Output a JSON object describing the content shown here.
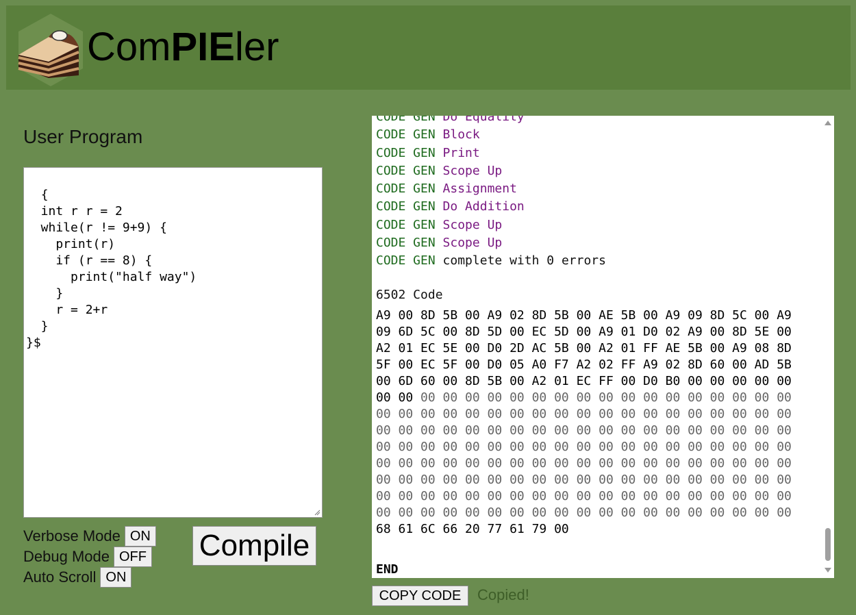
{
  "app": {
    "title_prefix": "Com",
    "title_bold": "PIE",
    "title_suffix": "ler",
    "logo_icon": "pie-slice-logo"
  },
  "editor": {
    "label": "User Program",
    "code": "{\n  int r r = 2\n  while(r != 9+9) {\n    print(r)\n    if (r == 8) {\n      print(\"half way\")\n    }\n    r = 2+r\n  }\n}$"
  },
  "options": {
    "verbose": {
      "label": "Verbose Mode",
      "value": "ON"
    },
    "debug": {
      "label": "Debug Mode",
      "value": "OFF"
    },
    "autoscroll": {
      "label": "Auto Scroll",
      "value": "ON"
    }
  },
  "compile_label": "Compile",
  "output": {
    "codegen_lines": [
      {
        "tag": "CODE GEN",
        "text": "Do Equality",
        "kind": "purple"
      },
      {
        "tag": "CODE GEN",
        "text": "Block",
        "kind": "purple"
      },
      {
        "tag": "CODE GEN",
        "text": "Print",
        "kind": "purple"
      },
      {
        "tag": "CODE GEN",
        "text": "Scope Up",
        "kind": "purple"
      },
      {
        "tag": "CODE GEN",
        "text": "Assignment",
        "kind": "purple"
      },
      {
        "tag": "CODE GEN",
        "text": "Do Addition",
        "kind": "purple"
      },
      {
        "tag": "CODE GEN",
        "text": "Scope Up",
        "kind": "purple"
      },
      {
        "tag": "CODE GEN",
        "text": "Scope Up",
        "kind": "purple"
      },
      {
        "tag": "CODE GEN",
        "text": "complete with 0 errors",
        "kind": "black"
      }
    ],
    "code_title": "6502 Code",
    "hex_lines": [
      {
        "dark": "A9 00 8D 5B 00 A9 02 8D 5B 00 AE 5B 00 A9 09 8D 5C 00 A9",
        "gray": ""
      },
      {
        "dark": "09 6D 5C 00 8D 5D 00 EC 5D 00 A9 01 D0 02 A9 00 8D 5E 00",
        "gray": ""
      },
      {
        "dark": "A2 01 EC 5E 00 D0 2D AC 5B 00 A2 01 FF AE 5B 00 A9 08 8D",
        "gray": ""
      },
      {
        "dark": "5F 00 EC 5F 00 D0 05 A0 F7 A2 02 FF A9 02 8D 60 00 AD 5B",
        "gray": ""
      },
      {
        "dark": "00 6D 60 00 8D 5B 00 A2 01 EC FF 00 D0 B0 00 00 00 00 00",
        "gray": ""
      },
      {
        "dark": "00 00",
        "gray": " 00 00 00 00 00 00 00 00 00 00 00 00 00 00 00 00 00"
      },
      {
        "dark": "",
        "gray": "00 00 00 00 00 00 00 00 00 00 00 00 00 00 00 00 00 00 00"
      },
      {
        "dark": "",
        "gray": "00 00 00 00 00 00 00 00 00 00 00 00 00 00 00 00 00 00 00"
      },
      {
        "dark": "",
        "gray": "00 00 00 00 00 00 00 00 00 00 00 00 00 00 00 00 00 00 00"
      },
      {
        "dark": "",
        "gray": "00 00 00 00 00 00 00 00 00 00 00 00 00 00 00 00 00 00 00"
      },
      {
        "dark": "",
        "gray": "00 00 00 00 00 00 00 00 00 00 00 00 00 00 00 00 00 00 00"
      },
      {
        "dark": "",
        "gray": "00 00 00 00 00 00 00 00 00 00 00 00 00 00 00 00 00 00 00"
      },
      {
        "dark": "",
        "gray": "00 00 00 00 00 00 00 00 00 00 00 00 00 00 00 00 00 00 00"
      },
      {
        "dark": "68 61 6C 66 20 77 61 79 00",
        "gray": ""
      }
    ],
    "end_label": "END"
  },
  "copy_label": "COPY CODE",
  "copied_label": "Copied!"
}
